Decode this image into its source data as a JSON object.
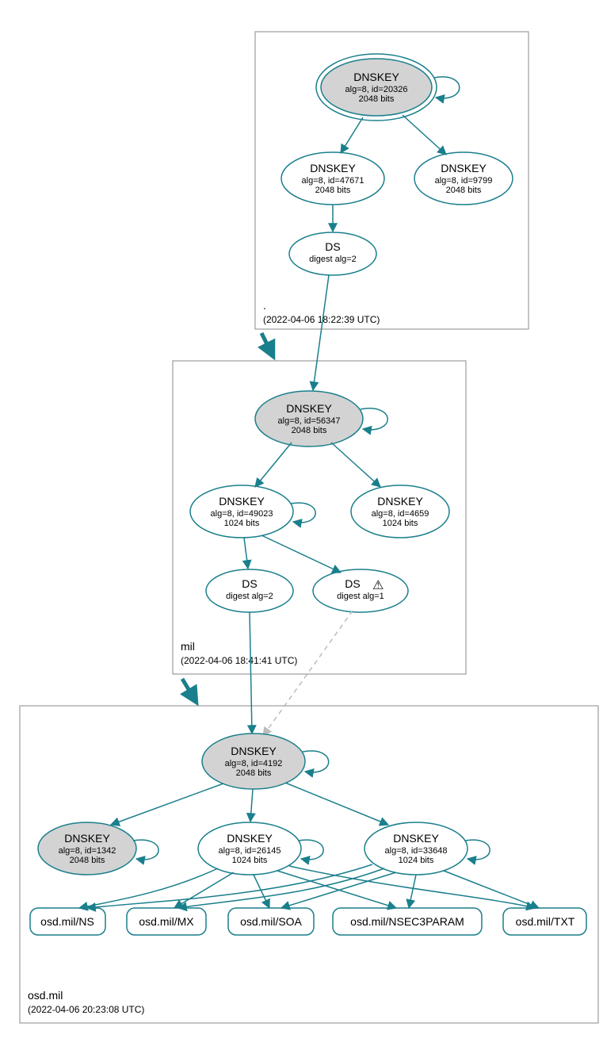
{
  "zones": {
    "root": {
      "label": ".",
      "time": "(2022-04-06 18:22:39 UTC)"
    },
    "mil": {
      "label": "mil",
      "time": "(2022-04-06 18:41:41 UTC)"
    },
    "osd": {
      "label": "osd.mil",
      "time": "(2022-04-06 20:23:08 UTC)"
    }
  },
  "nodes": {
    "root_ksk": {
      "title": "DNSKEY",
      "sub1": "alg=8, id=20326",
      "sub2": "2048 bits"
    },
    "root_zsk1": {
      "title": "DNSKEY",
      "sub1": "alg=8, id=47671",
      "sub2": "2048 bits"
    },
    "root_zsk2": {
      "title": "DNSKEY",
      "sub1": "alg=8, id=9799",
      "sub2": "2048 bits"
    },
    "root_ds": {
      "title": "DS",
      "sub1": "digest alg=2",
      "sub2": ""
    },
    "mil_ksk": {
      "title": "DNSKEY",
      "sub1": "alg=8, id=56347",
      "sub2": "2048 bits"
    },
    "mil_zsk1": {
      "title": "DNSKEY",
      "sub1": "alg=8, id=49023",
      "sub2": "1024 bits"
    },
    "mil_zsk2": {
      "title": "DNSKEY",
      "sub1": "alg=8, id=4659",
      "sub2": "1024 bits"
    },
    "mil_ds1": {
      "title": "DS",
      "sub1": "digest alg=2",
      "sub2": ""
    },
    "mil_ds2": {
      "title": "DS",
      "sub1": "digest alg=1",
      "sub2": ""
    },
    "osd_ksk": {
      "title": "DNSKEY",
      "sub1": "alg=8, id=4192",
      "sub2": "2048 bits"
    },
    "osd_k1": {
      "title": "DNSKEY",
      "sub1": "alg=8, id=1342",
      "sub2": "2048 bits"
    },
    "osd_k2": {
      "title": "DNSKEY",
      "sub1": "alg=8, id=26145",
      "sub2": "1024 bits"
    },
    "osd_k3": {
      "title": "DNSKEY",
      "sub1": "alg=8, id=33648",
      "sub2": "1024 bits"
    },
    "rr_ns": {
      "label": "osd.mil/NS"
    },
    "rr_mx": {
      "label": "osd.mil/MX"
    },
    "rr_soa": {
      "label": "osd.mil/SOA"
    },
    "rr_nsec": {
      "label": "osd.mil/NSEC3PARAM"
    },
    "rr_txt": {
      "label": "osd.mil/TXT"
    }
  },
  "warning_icon": "⚠"
}
